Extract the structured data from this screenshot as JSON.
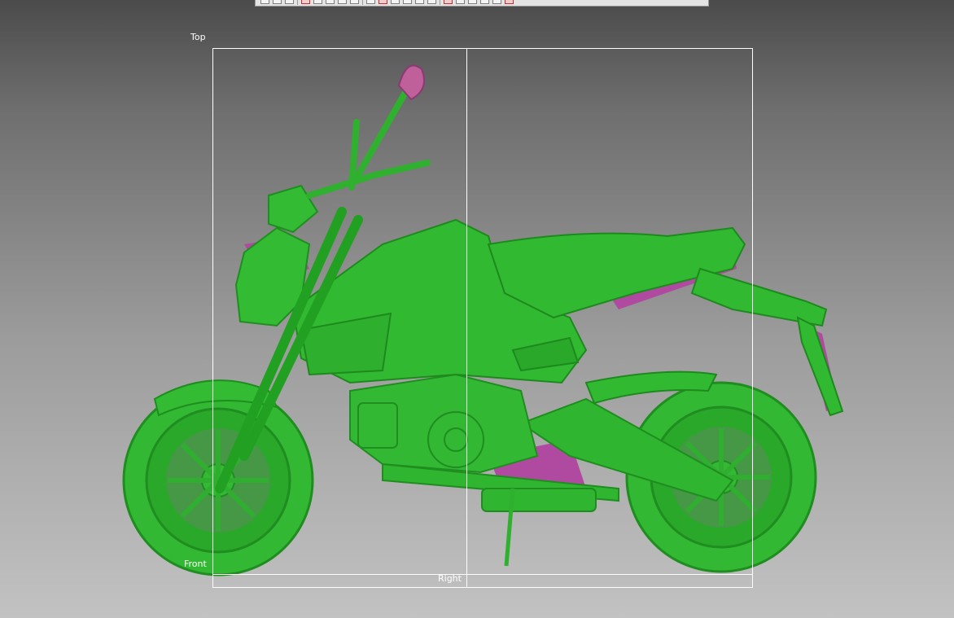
{
  "viewport": {
    "labels": {
      "top": "Top",
      "front": "Front",
      "right": "Right"
    }
  },
  "toolbar": {
    "buttons": [
      "view-icon",
      "open-icon",
      "save-icon",
      "undo-icon",
      "select-icon",
      "box-icon",
      "frame-icon",
      "grid-icon",
      "columns-icon",
      "pointer-icon",
      "measure-icon",
      "rotate-icon",
      "pan-icon",
      "zoom-icon",
      "fit-icon",
      "render-icon",
      "light-icon",
      "display-icon",
      "settings-icon",
      "close-icon"
    ]
  },
  "model": {
    "name": "motorcycle-scan",
    "primary_color": "#2fb52f",
    "deviation_color": "#b04aa0"
  },
  "colors": {
    "frame_lines": "#ffffff"
  }
}
